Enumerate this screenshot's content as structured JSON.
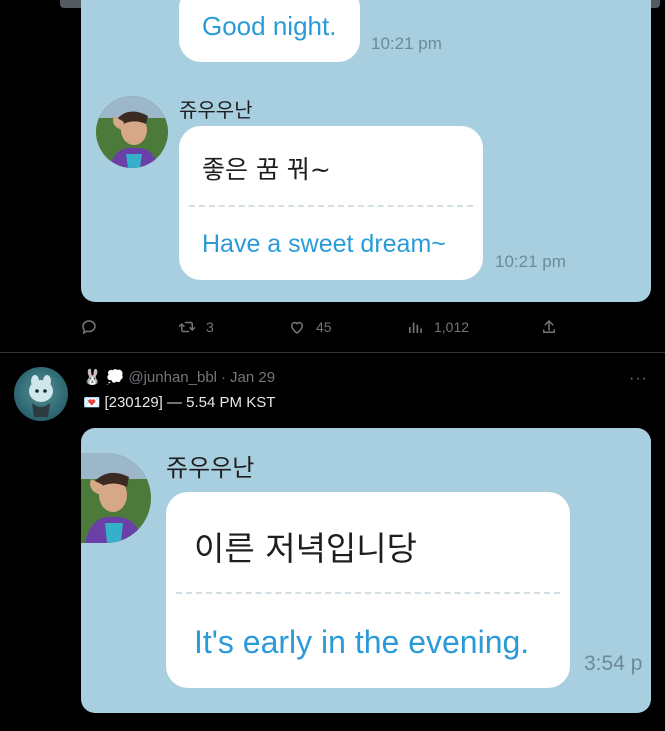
{
  "card1": {
    "prev_bubble_text": "Good night.",
    "prev_time": "10:21 pm",
    "sender": "쥬우우난",
    "korean": "좋은 꿈 꿔~",
    "english": "Have a sweet dream~",
    "time": "10:21 pm"
  },
  "actions": {
    "reply_count": "",
    "retweet_count": "3",
    "like_count": "45",
    "view_count": "1,012"
  },
  "tweet2": {
    "handle": "@junhan_bbl",
    "separator": "·",
    "date": "Jan 29",
    "text": "[230129] — 5.54 PM KST",
    "more_label": "···"
  },
  "card2": {
    "sender": "쥬우우난",
    "korean": "이른 저녁입니당",
    "english": "It's early in the evening.",
    "time": "3:54 p"
  },
  "colors": {
    "background": "#000000",
    "card": "#a8cfe0",
    "english_text": "#2a9bd8",
    "muted": "#71767b"
  }
}
